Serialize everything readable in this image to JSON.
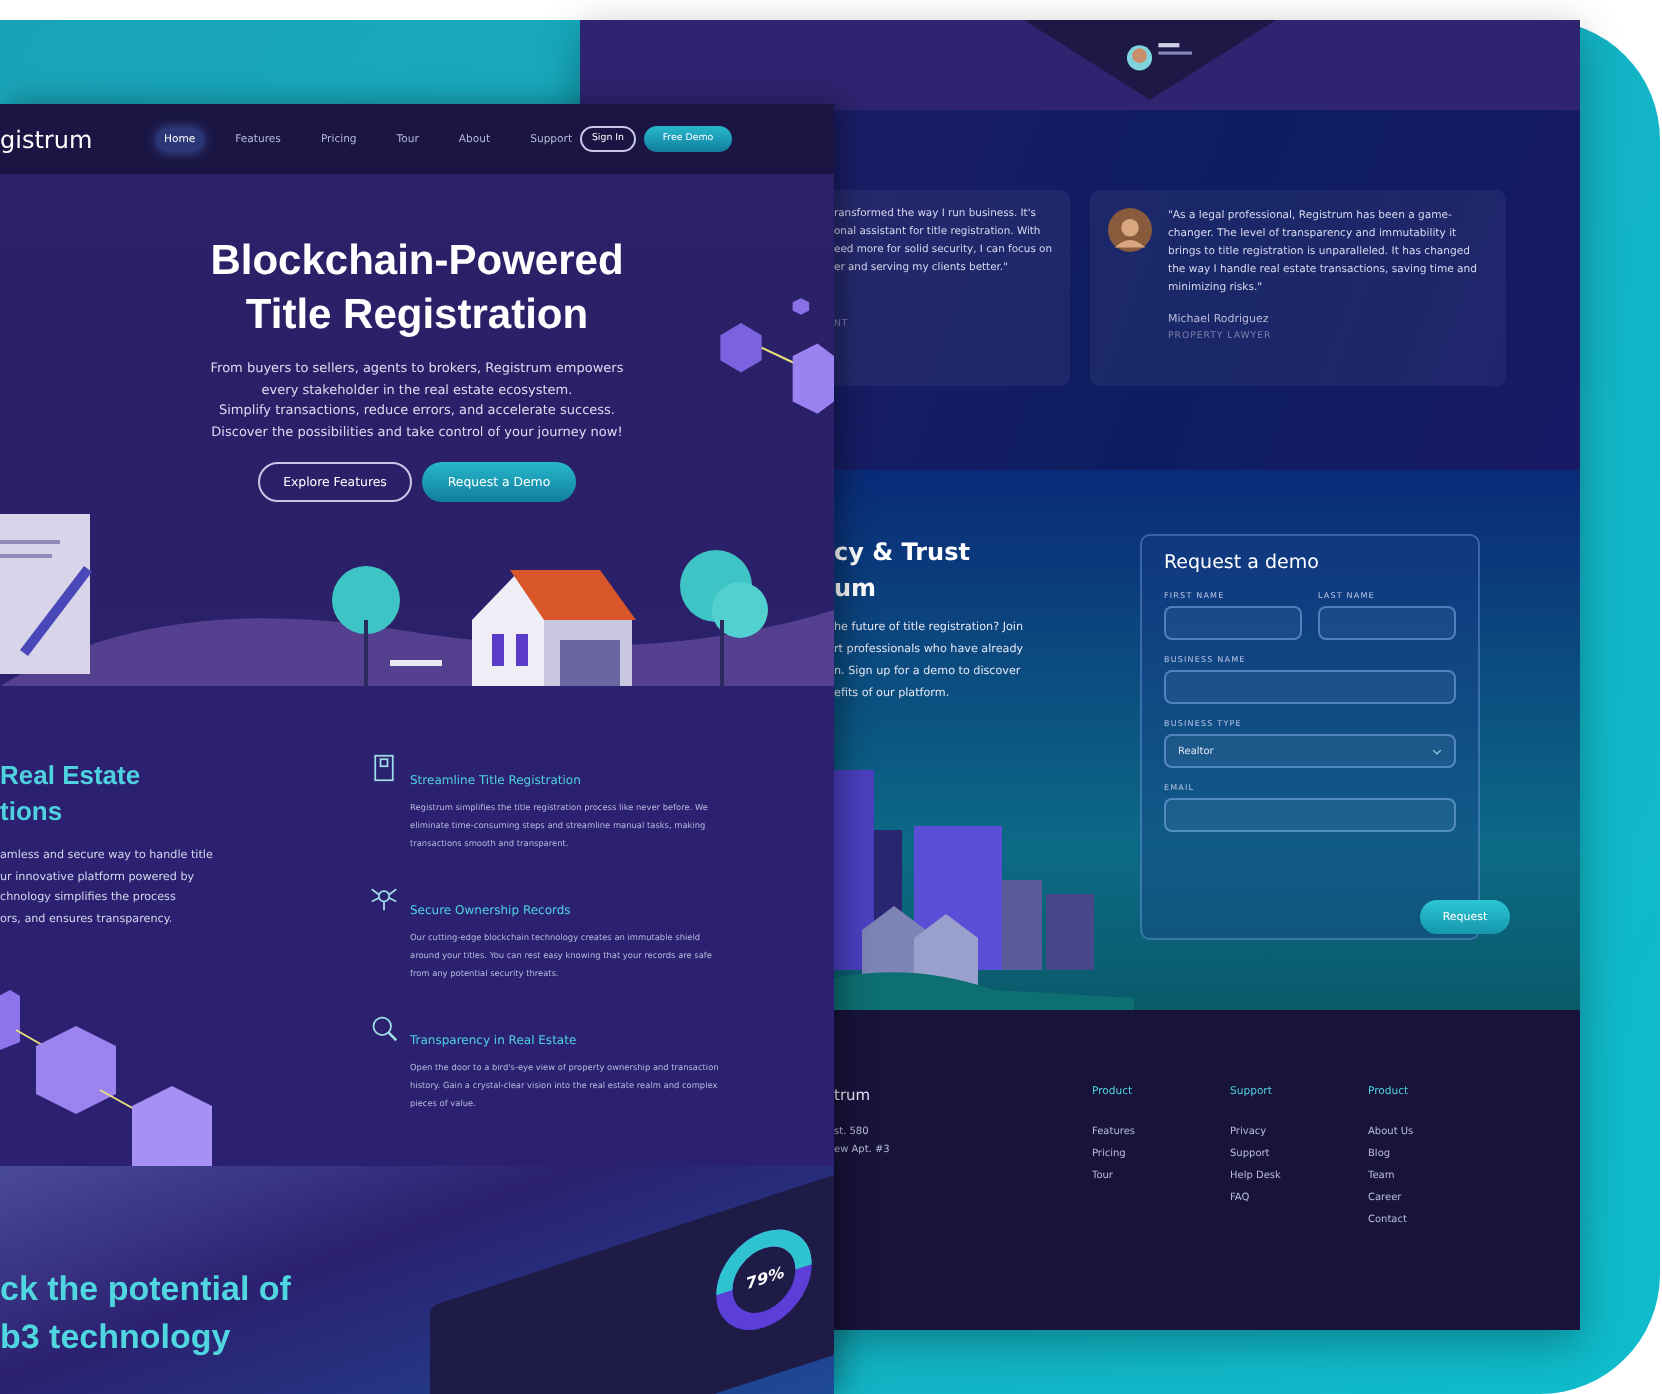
{
  "front_page": {
    "nav": {
      "logo": "gistrum",
      "links": [
        {
          "label": "Home",
          "selected": true
        },
        {
          "label": "Features",
          "selected": false
        },
        {
          "label": "Pricing",
          "selected": false
        },
        {
          "label": "Tour",
          "selected": false
        },
        {
          "label": "About",
          "selected": false
        },
        {
          "label": "Support",
          "selected": false
        }
      ],
      "sign_in": "Sign In",
      "demo": "Free Demo"
    },
    "hero": {
      "title_lines": [
        "Blockchain-Powered",
        "Title Registration"
      ],
      "text": "From buyers to sellers, agents to brokers, Registrum empowers\nevery stakeholder in the real estate ecosystem.\nSimplify transactions, reduce errors, and accelerate success.\nDiscover the possibilities and take control of your journey now!",
      "buttons": [
        "Explore Features",
        "Request a Demo"
      ]
    },
    "solutions": {
      "heading_lines": [
        "Real Estate",
        "tions"
      ],
      "text": "amless and secure way to handle title\nur innovative platform powered by\nchnology simplifies the process\nors, and ensures transparency.",
      "features": [
        {
          "kind": "document",
          "title": "Streamline Title Registration",
          "text": "Registrum simplifies the title registration process like never before. We eliminate time-consuming steps and streamline manual tasks, making transactions smooth and transparent."
        },
        {
          "kind": "network",
          "title": "Secure Ownership Records",
          "text": "Our cutting-edge blockchain technology creates an immutable shield around your titles. You can rest easy knowing that your records are safe from any potential security threats."
        },
        {
          "kind": "magnifier",
          "title": "Transparency in Real Estate",
          "text": "Open the door to a bird's-eye view of property ownership and transaction history. Gain a crystal-clear vision into the real estate realm and complex pieces of value."
        }
      ]
    },
    "web3": {
      "heading_lines": [
        "ck the potential of",
        "b3 technology"
      ],
      "gauge": "79%"
    }
  },
  "back_page": {
    "testimonials": [
      {
        "text": "ransformed the way I run business. It's\nonal assistant for title registration. With\need more for solid security, I can focus on\ner and serving my clients better.\"",
        "role": "NT"
      },
      {
        "text": "\"As a legal professional, Registrum has been a game-changer. The level of transparency and immutability it brings to title registration is unparalleled. It has changed the way I handle real estate transactions, saving time and minimizing risks.\"",
        "name": "Michael Rodriguez",
        "role": "PROPERTY LAWYER"
      }
    ],
    "demo": {
      "heading_lines": [
        "cy & Trust",
        "um"
      ],
      "text": "he future of title registration? Join\nrt professionals who have already\nn. Sign up for a demo to discover\nefits of our platform.",
      "form": {
        "title": "Request a demo",
        "first_name": "FIRST NAME",
        "last_name": "LAST NAME",
        "business_name": "BUSINESS NAME",
        "business_type": "BUSINESS TYPE",
        "business_type_value": "Realtor",
        "email": "EMAIL",
        "submit": "Request"
      }
    },
    "footer": {
      "brand": "trum",
      "address": [
        "st. 580",
        "ew Apt. #3"
      ],
      "columns": [
        {
          "title": "Product",
          "links": [
            "Features",
            "Pricing",
            "Tour"
          ]
        },
        {
          "title": "Support",
          "links": [
            "Privacy",
            "Support",
            "Help Desk",
            "FAQ"
          ]
        },
        {
          "title": "Product",
          "links": [
            "About Us",
            "Blog",
            "Team",
            "Career",
            "Contact"
          ]
        }
      ]
    }
  }
}
